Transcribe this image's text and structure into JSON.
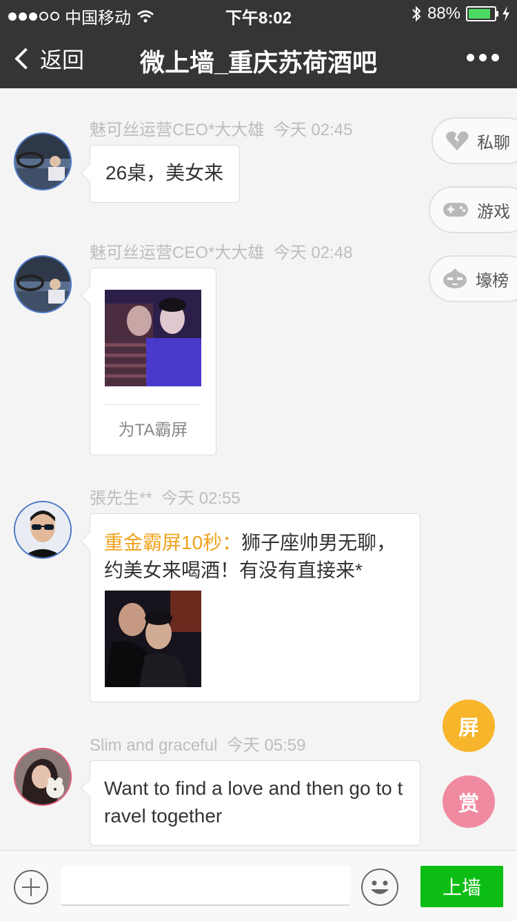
{
  "status_bar": {
    "carrier": "中国移动",
    "time": "下午8:02",
    "battery": "88%"
  },
  "nav": {
    "back_label": "返回",
    "title": "微上墙_重庆苏荷酒吧"
  },
  "messages": [
    {
      "author": "魅可丝运营CEO*大大雄",
      "time": "今天 02:45",
      "text": "26桌，美女来"
    },
    {
      "author": "魅可丝运营CEO*大大雄",
      "time": "今天 02:48",
      "action": "为TA霸屏"
    },
    {
      "author": "張先生**",
      "time": "今天 02:55",
      "tag": "重金霸屏10秒：",
      "text": "狮子座帅男无聊，约美女来喝酒！有没有直接来*"
    },
    {
      "author": "Slim and graceful",
      "time": "今天 05:59",
      "text": "Want to find a love and then go to travel together"
    }
  ],
  "side_buttons": {
    "private_chat": "私聊",
    "games": "游戏",
    "ranking": "壕榜"
  },
  "fabs": {
    "screen": "屏",
    "reward": "赏"
  },
  "bottom": {
    "input_value": "",
    "send_label": "上墙"
  },
  "colors": {
    "accent_green": "#0bbd14",
    "screen_yellow": "#f7b52c",
    "reward_pink": "#f08aa0",
    "tag_gold": "#f0a21c"
  }
}
